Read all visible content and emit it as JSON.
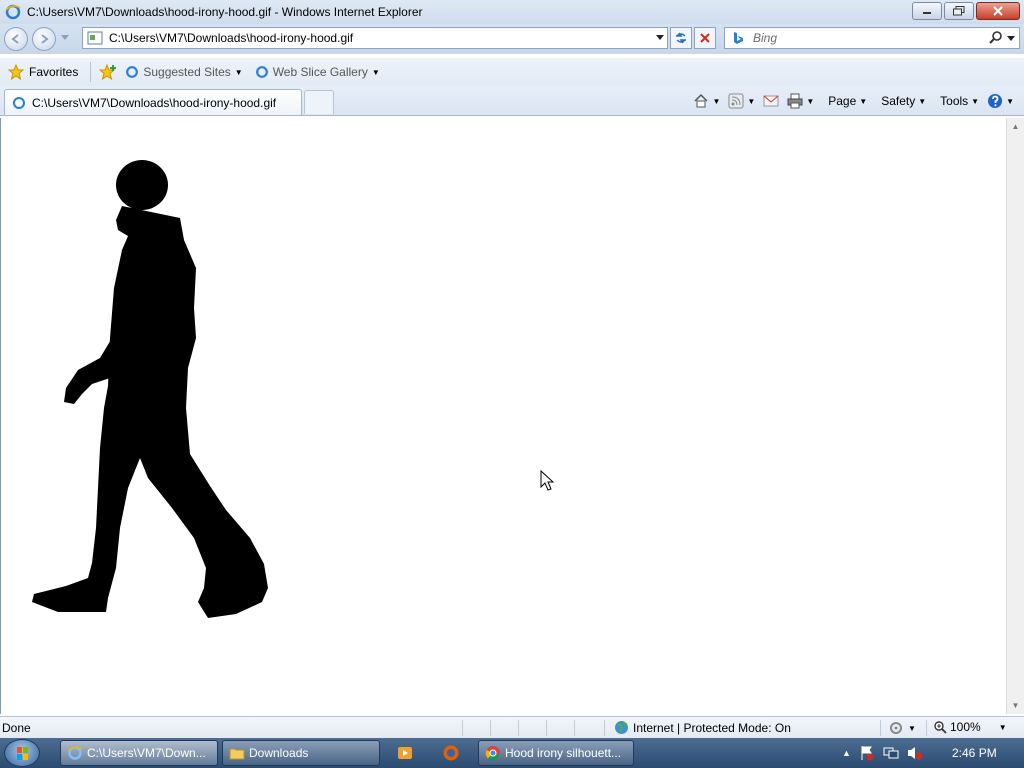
{
  "window": {
    "title": "C:\\Users\\VM7\\Downloads\\hood-irony-hood.gif - Windows Internet Explorer"
  },
  "navbar": {
    "address": "C:\\Users\\VM7\\Downloads\\hood-irony-hood.gif",
    "search_placeholder": "Bing"
  },
  "favorites_bar": {
    "favorites_label": "Favorites",
    "suggested_sites_label": "Suggested Sites",
    "web_slice_gallery_label": "Web Slice Gallery"
  },
  "tabs": [
    {
      "label": "C:\\Users\\VM7\\Downloads\\hood-irony-hood.gif"
    }
  ],
  "command_bar": {
    "page_label": "Page",
    "safety_label": "Safety",
    "tools_label": "Tools"
  },
  "status_bar": {
    "status_text": "Done",
    "zone_text": "Internet | Protected Mode: On",
    "zoom_text": "100%"
  },
  "taskbar": {
    "items": [
      {
        "label": "C:\\Users\\VM7\\Down..."
      },
      {
        "label": "Downloads"
      },
      {
        "label": "Hood irony silhouett..."
      }
    ],
    "clock": "2:46 PM"
  },
  "colors": {
    "silhouette": "#000000",
    "chrome": "#d5e2f2",
    "taskbar": "#2b4a70"
  },
  "icons": [
    "ie-icon",
    "back-arrow-icon",
    "forward-arrow-icon",
    "page-icon",
    "refresh-icon",
    "stop-icon",
    "bing-icon",
    "search-icon",
    "star-icon",
    "add-favorites-icon",
    "home-icon",
    "rss-icon",
    "mail-icon",
    "print-icon",
    "help-icon",
    "globe-icon",
    "zoom-icon",
    "folder-icon",
    "media-player-icon",
    "firefox-icon",
    "chrome-icon",
    "windows-start-icon",
    "mouse-cursor-icon"
  ]
}
